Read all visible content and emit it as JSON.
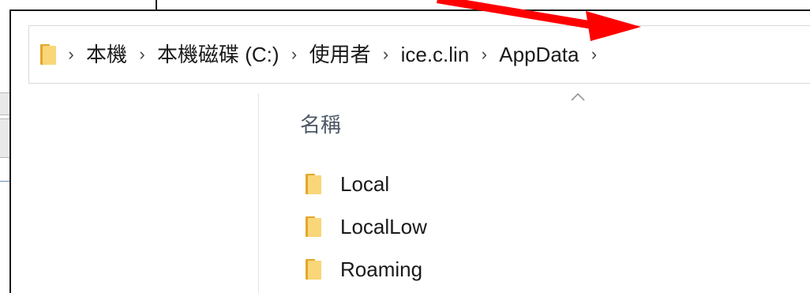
{
  "address_bar": {
    "breadcrumbs": [
      "本機",
      "本機磁碟 (C:)",
      "使用者",
      "ice.c.lin",
      "AppData"
    ],
    "separator": "›",
    "icon": "folder-icon"
  },
  "file_list": {
    "column_header": "名稱",
    "sort_icon": "chevron-up-icon",
    "items": [
      {
        "name": "Local",
        "icon": "folder-icon"
      },
      {
        "name": "LocalLow",
        "icon": "folder-icon"
      },
      {
        "name": "Roaming",
        "icon": "folder-icon"
      }
    ]
  },
  "annotation": {
    "type": "arrow",
    "color": "#ff0000",
    "points_to": "AppData"
  },
  "colors": {
    "folder_back": "#e2a72c",
    "folder_front": "#f9d677",
    "header_text": "#4c5766"
  }
}
